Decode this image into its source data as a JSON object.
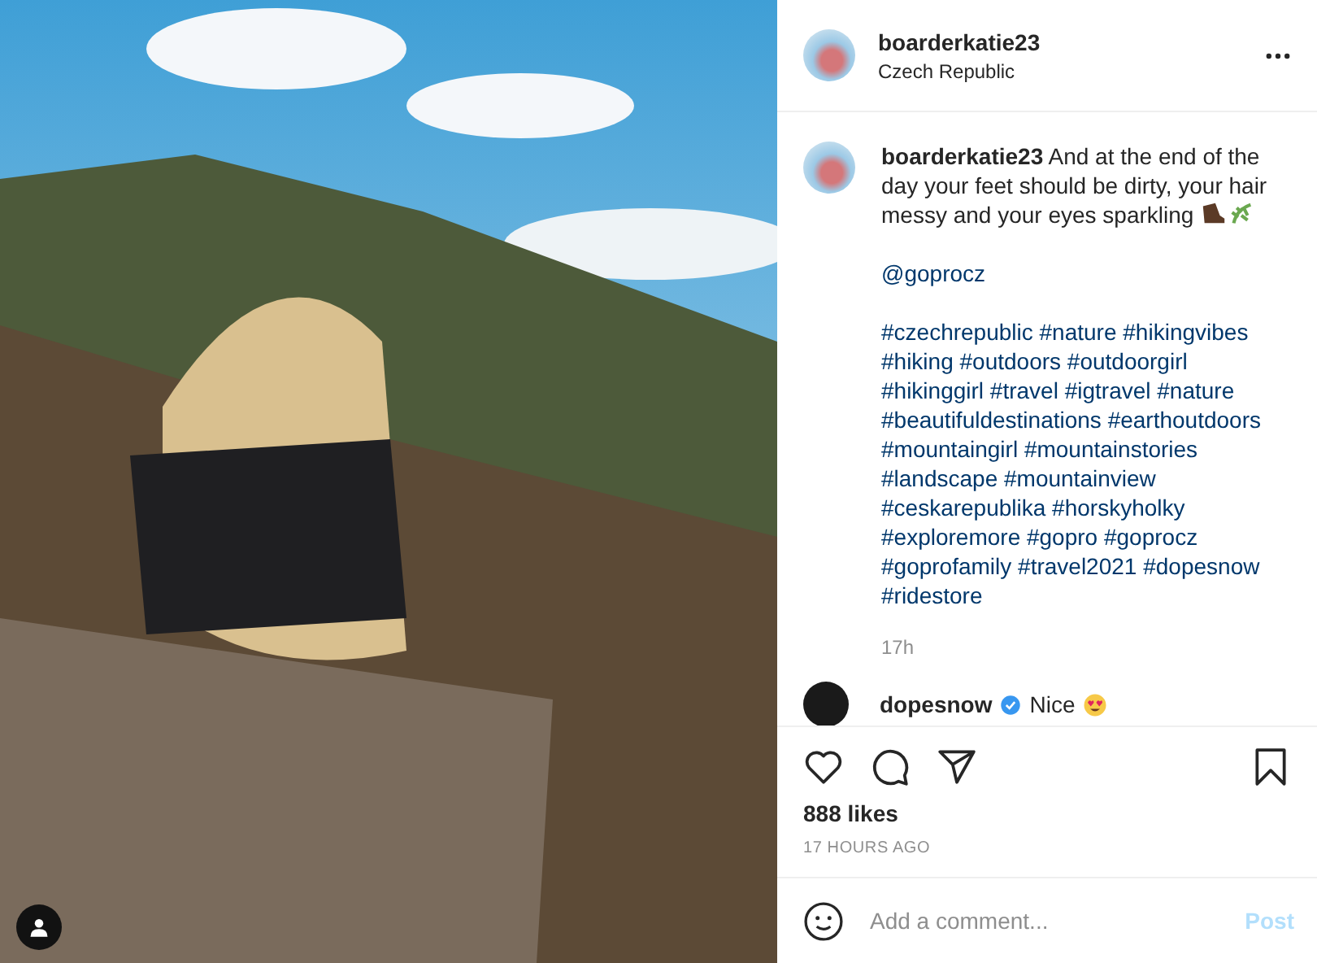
{
  "post_header": {
    "username": "boarderkatie23",
    "location": "Czech Republic"
  },
  "caption": {
    "username": "boarderkatie23",
    "text": "And at the end of the day your feet should be dirty, your hair messy and your eyes sparkling",
    "mention": "@goprocz",
    "hashtags": "#czechrepublic #nature #hikingvibes #hiking #outdoors #outdoorgirl #hikinggirl #travel #igtravel #nature #beautifuldestinations #earthoutdoors #mountaingirl #mountainstories #landscape #mountainview #ceskarepublika #horskyholky #exploremore #gopro #goprocz #goprofamily #travel2021 #dopesnow #ridestore",
    "time": "17h"
  },
  "comments": [
    {
      "username": "dopesnow",
      "verified": true,
      "text": "Nice"
    }
  ],
  "actions": {
    "liked": false,
    "saved": false
  },
  "likes": "888 likes",
  "timestamp": "17 HOURS AGO",
  "comment_box": {
    "placeholder": "Add a comment...",
    "post_label": "Post",
    "disabled": true
  }
}
